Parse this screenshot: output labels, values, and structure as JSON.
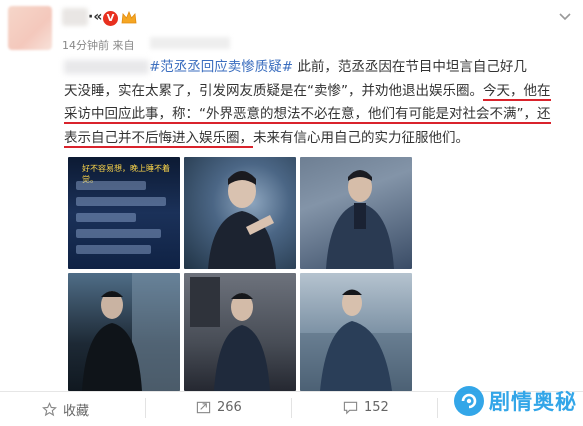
{
  "header": {
    "username_suffix": "·«",
    "vip_badge": "V",
    "timestamp": "14分钟前",
    "source_prefix": "来自"
  },
  "post": {
    "hashtag": "#范丞丞回应卖惨质疑#",
    "line1": "此前，范丞丞因在节目中坦言自己好几",
    "line2_a": "天没睡，实在太累了，引发网友质疑是在“卖惨”，并劝他退出娱乐圈。",
    "line2_b": "今天，他在",
    "line3_a": "采访中回应此事，称：“外界恶意的想法不必在意，",
    "line3_b": "他们有可能是对社会不满”，还",
    "line4_a": "表示自己并不后悔进入娱乐圈，",
    "line4_b": "未来有信心用自己的实力征服他们。"
  },
  "photos": {
    "screenshot_caption": "好不容易想，晚上睡不着觉。"
  },
  "actions": {
    "favorite_label": "收藏",
    "repost_count": "266",
    "comment_count": "152"
  },
  "watermark": {
    "text": "剧情奥秘"
  },
  "colors": {
    "link": "#3b6ebf",
    "underline": "#d9232c",
    "vip": "#e8301f",
    "brand": "#1e9de6"
  }
}
